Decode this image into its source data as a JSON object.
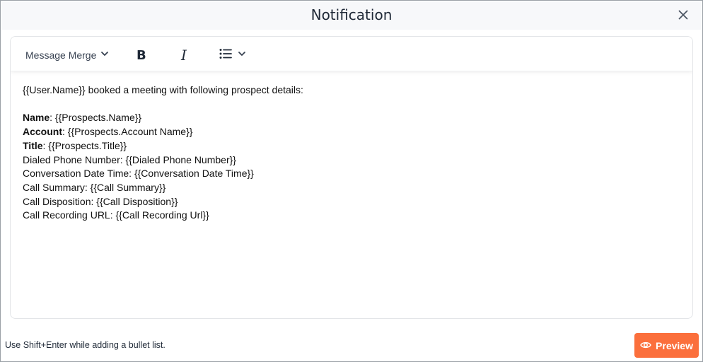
{
  "header": {
    "title": "Notification"
  },
  "toolbar": {
    "merge_label": "Message Merge",
    "bold_label": "B",
    "italic_label": "I"
  },
  "content": {
    "intro": "{{User.Name}} booked a meeting with following prospect details:",
    "fields": [
      {
        "bold_label": "Name",
        "rest": ": {{Prospects.Name}}"
      },
      {
        "bold_label": "Account",
        "rest": ": {{Prospects.Account Name}}"
      },
      {
        "bold_label": "Title",
        "rest": ": {{Prospects.Title}}"
      }
    ],
    "lines": [
      "Dialed Phone Number: {{Dialed Phone Number}}",
      "Conversation Date Time: {{Conversation Date Time}}",
      "Call Summary: {{Call Summary}}",
      "Call Disposition: {{Call Disposition}}",
      "Call Recording URL: {{Call Recording Url}}"
    ]
  },
  "footer": {
    "hint": "Use Shift+Enter while adding a bullet list.",
    "preview_label": "Preview"
  },
  "colors": {
    "accent": "#fb6f3c",
    "header_bg": "#f7f8fa"
  }
}
